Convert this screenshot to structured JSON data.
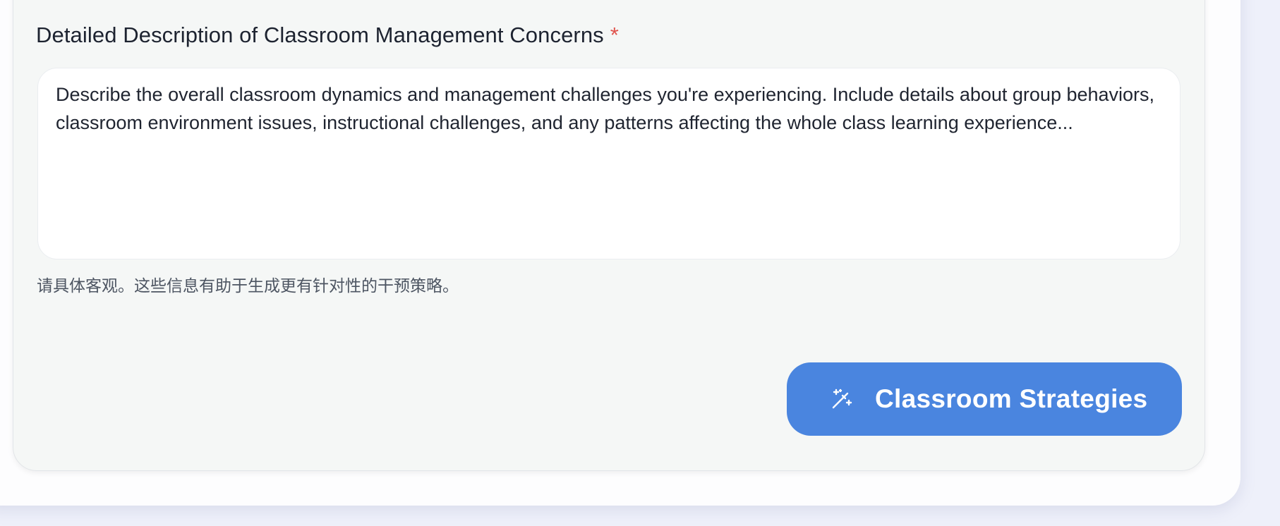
{
  "form": {
    "label": "Detailed Description of Classroom Management Concerns",
    "required_marker": "*",
    "textarea": {
      "placeholder": "Describe the overall classroom dynamics and management challenges you're experiencing. Include details about group behaviors, classroom environment issues, instructional challenges, and any patterns affecting the whole class learning experience..."
    },
    "helper_text": "请具体客观。这些信息有助于生成更有针对性的干预策略。"
  },
  "actions": {
    "submit_label": "Classroom Strategies",
    "submit_icon": "magic-wand-icon"
  },
  "colors": {
    "accent": "#4a85df",
    "required": "#e0534d",
    "panel_background": "#f5f7f6",
    "page_background": "#eef0fa"
  }
}
